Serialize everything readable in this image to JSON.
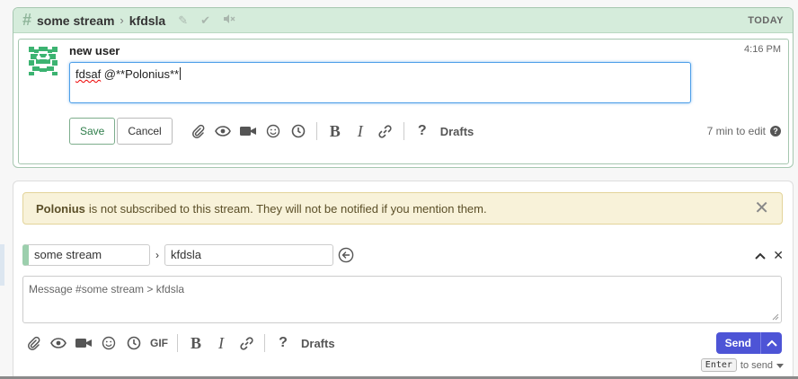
{
  "recipient_bar": {
    "stream": "some stream",
    "topic": "kfdsla",
    "date_label": "TODAY"
  },
  "message": {
    "sender": "new user",
    "time": "4:16 PM",
    "edit_text_misspelled": "fdsaf",
    "edit_text_rest": " @**Polonius**",
    "save_label": "Save",
    "cancel_label": "Cancel",
    "drafts_label": "Drafts",
    "edit_hint": "7 min to edit"
  },
  "compose": {
    "warning_name": "Polonius",
    "warning_text": "is not subscribed to this stream. They will not be notified if you mention them.",
    "stream_value": "some stream",
    "topic_value": "kfdsla",
    "message_placeholder": "Message #some stream > kfdsla",
    "gif_label": "GIF",
    "drafts_label": "Drafts",
    "send_label": "Send",
    "enter_key": "Enter",
    "enter_hint": "to send"
  },
  "colors": {
    "stream_color": "#9ccfad",
    "send_button": "#4d54d6",
    "warning_bg": "#f8f2d9",
    "edit_focus": "#4c9ee8"
  },
  "icons": [
    "hash-icon",
    "chevron-right-icon",
    "pencil-icon",
    "check-icon",
    "mute-icon",
    "paperclip-icon",
    "eye-icon",
    "video-icon",
    "smiley-icon",
    "clock-icon",
    "bold-icon",
    "italic-icon",
    "link-icon",
    "help-icon",
    "close-icon",
    "circle-arrow-left-icon",
    "chevron-up-icon",
    "gif-icon"
  ]
}
